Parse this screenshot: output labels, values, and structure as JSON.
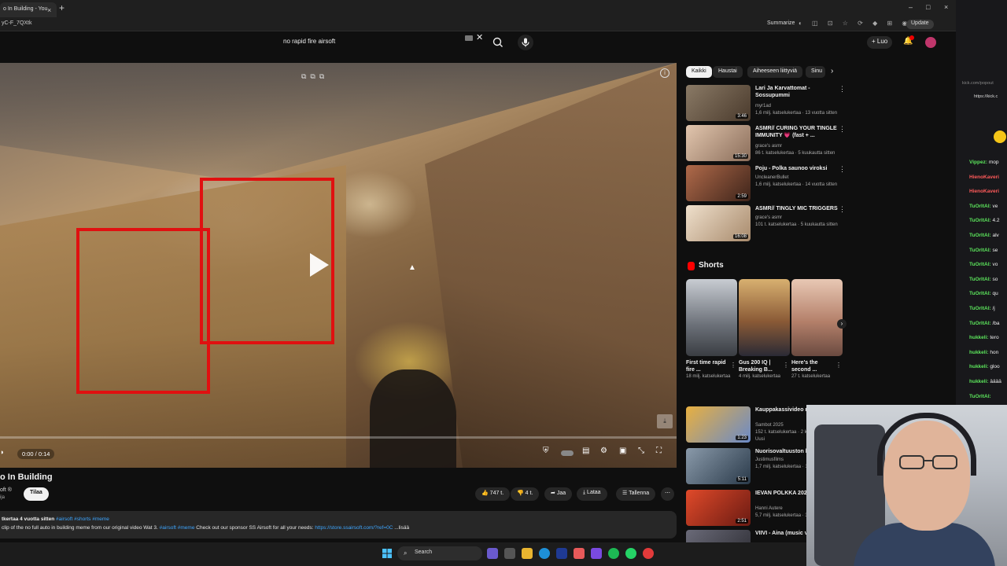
{
  "browser": {
    "tab_title": "o In Building - You",
    "tab_close": "×",
    "new_tab": "+",
    "url": "yC-F_7QXtk",
    "summarize": "Summarize",
    "update": "Update",
    "win_min": "–",
    "win_max": "□",
    "win_close": "×"
  },
  "header": {
    "search_query": "no rapid fire airsoft",
    "clear": "✕",
    "create_label": "+ Luo",
    "bell": "🔔"
  },
  "player": {
    "time": "0:00 / 0:14",
    "progress": 0.0,
    "info": "i",
    "endcard": "⤓"
  },
  "video": {
    "title": "o In Building",
    "channel": "oft ®",
    "channel_sub": "ija",
    "subscribe": "Tilaa",
    "likes": "747 t.",
    "dislikes": "4 t.",
    "share": "Jaa",
    "download": "Lataa",
    "save": "Tallenna",
    "more": "⋯",
    "desc_meta": "tkertaa  4 vuotta sitten",
    "desc_tags": "#airsoft #shorts #meme",
    "desc_text_1": "clip of the no full auto in building meme from our original video Wat 3.",
    "desc_text_tags": "#airsoft #meme",
    "desc_text_2": "Check out our sponsor SS Airsoft for all your needs:",
    "desc_link": "https://store.ssairsoft.com/?ref=0C",
    "desc_more": "...lisää"
  },
  "chips": [
    {
      "label": "Kaikki",
      "active": true
    },
    {
      "label": "Haustai",
      "active": false
    },
    {
      "label": "Aiheeseen liittyviä",
      "active": false
    },
    {
      "label": "Sinu",
      "active": false
    }
  ],
  "recommendations": [
    {
      "title": "Lari Ja Karvattomat - Sossupummi",
      "channel": "myr1ad",
      "meta": "1,6 milj. katselukertaa · 13 vuotta sitten",
      "duration": "3:46",
      "color": "#6b5a4a"
    },
    {
      "title": "ASMR// CURING YOUR TINGLE IMMUNITY 💗 (fast + ...",
      "channel": "grace's asmr",
      "meta": "86 t. katselukertaa · 5 kuukautta sitten",
      "duration": "15:30",
      "color": "#c9a58c"
    },
    {
      "title": "Poju - Polka saunoo viroksi",
      "channel": "UncleanerBullet",
      "meta": "1,6 milj. katselukertaa · 14 vuotta sitten",
      "duration": "2:59",
      "color": "#7a4a36"
    },
    {
      "title": "ASMR// TINGLY MIC TRIGGERS",
      "channel": "grace's asmr",
      "meta": "101 t. katselukertaa · 5 kuukautta sitten",
      "duration": "16:08",
      "color": "#d8c2a8"
    }
  ],
  "recommendations_lower": [
    {
      "title": "Kauppakassivideo nu edition",
      "channel": "Sambot 2025",
      "meta": "152 t. katselukertaa · 2 kuukaut",
      "extra": "Uusi",
      "duration": "1:23",
      "color": "#c4923a"
    },
    {
      "title": "Nuorisovaltuuston k",
      "channel": "Justimusfilms",
      "meta": "1,7 milj. katselukertaa · 11 vuotta",
      "extra": "",
      "duration": "5:11",
      "color": "#5a6a7a"
    },
    {
      "title": "IEVAN POLKKA 2021 LOITUMA",
      "channel": "Hanni Autere",
      "meta": "5,7 milj. katselukertaa · 3 vuotta",
      "extra": "",
      "duration": "2:51",
      "color": "#a82a1e"
    },
    {
      "title": "VIIVI - Aina (music v",
      "channel": "",
      "meta": "",
      "extra": "",
      "duration": "",
      "color": "#4a4a55"
    }
  ],
  "shorts": {
    "heading": "Shorts",
    "items": [
      {
        "title": "First time rapid fire ...",
        "views": "18 milj. katselukertaa",
        "color": "#8a8f98"
      },
      {
        "title": "Gus 200 IQ | Breaking B...",
        "views": "4 milj. katselukertaa",
        "color": "#c2a070"
      },
      {
        "title": "Here's the second ...",
        "views": "27 t. katselukertaa",
        "color": "#b88a78"
      }
    ]
  },
  "chat": {
    "url_top": "kick.com/popout",
    "url": "https://kick.c",
    "lines": [
      {
        "user": "Vippez:",
        "msg": "mop",
        "color": "#5ce65c"
      },
      {
        "user": "HienoKaveri",
        "msg": "",
        "color": "#ff5a5a"
      },
      {
        "user": "HienoKaveri",
        "msg": "",
        "color": "#ff5a5a"
      },
      {
        "user": "TuOrltAI:",
        "msg": "ve",
        "color": "#5ce65c"
      },
      {
        "user": "TuOrltAI:",
        "msg": "4.2",
        "color": "#5ce65c"
      },
      {
        "user": "TuOrltAI:",
        "msg": "alv",
        "color": "#5ce65c"
      },
      {
        "user": "TuOrltAI:",
        "msg": "se",
        "color": "#5ce65c"
      },
      {
        "user": "TuOrltAI:",
        "msg": "vo",
        "color": "#5ce65c"
      },
      {
        "user": "TuOrltAI:",
        "msg": "so",
        "color": "#5ce65c"
      },
      {
        "user": "TuOrltAI:",
        "msg": "qu",
        "color": "#5ce65c"
      },
      {
        "user": "TuOrltAI:",
        "msg": "/j",
        "color": "#5ce65c"
      },
      {
        "user": "TuOrltAI:",
        "msg": "/ba",
        "color": "#5ce65c"
      },
      {
        "user": "hukkeli:",
        "msg": "tero",
        "color": "#5ce65c"
      },
      {
        "user": "hukkeli:",
        "msg": "hon",
        "color": "#5ce65c"
      },
      {
        "user": "hukkeli:",
        "msg": "gloo",
        "color": "#5ce65c"
      },
      {
        "user": "hukkeli:",
        "msg": "ääää",
        "color": "#5ce65c"
      },
      {
        "user": "TuOrltAI:",
        "msg": "",
        "color": "#5ce65c"
      }
    ]
  },
  "taskbar": {
    "search": "Search"
  }
}
